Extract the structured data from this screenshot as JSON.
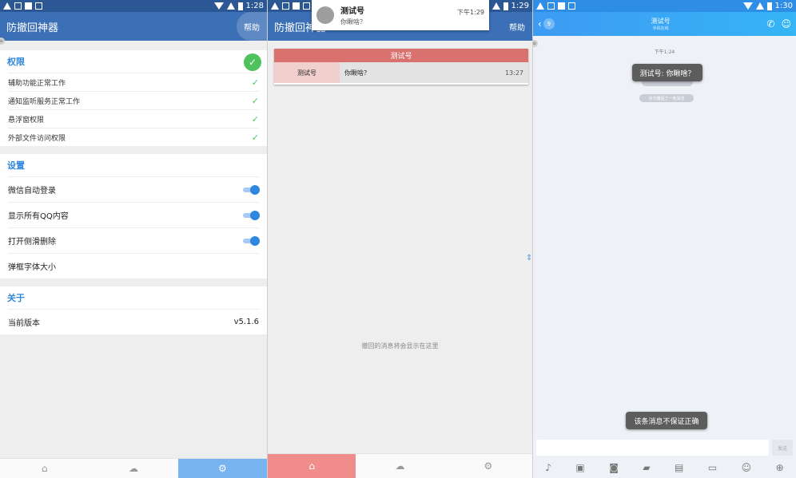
{
  "panel1": {
    "status_time": "1:28",
    "app_title": "防撤回神器",
    "help_label": "帮助",
    "permissions": {
      "title": "权限",
      "items": [
        {
          "label": "辅助功能正常工作"
        },
        {
          "label": "通知监听服务正常工作"
        },
        {
          "label": "悬浮窗权限"
        },
        {
          "label": "外部文件访问权限"
        }
      ]
    },
    "settings": {
      "title": "设置",
      "items": [
        {
          "label": "微信自动登录",
          "toggle": true
        },
        {
          "label": "显示所有QQ内容",
          "toggle": true
        },
        {
          "label": "打开侧滑删除",
          "toggle": true
        },
        {
          "label": "弹框字体大小",
          "toggle": null
        }
      ]
    },
    "about": {
      "title": "关于",
      "version_label": "当前版本",
      "version_value": "v5.1.6"
    }
  },
  "panel2": {
    "status_time": "1:29",
    "app_title": "防撤回神器",
    "help_label": "帮助",
    "notification": {
      "title": "测试号",
      "body": "你瞅啥？",
      "time": "下午1:29"
    },
    "recall_card": {
      "header": "测试号",
      "name": "测试号",
      "message": "你瞅啥？",
      "time": "13:27"
    },
    "empty_text": "撤回的消息将会显示在这里"
  },
  "panel3": {
    "status_time": "1:30",
    "back_badge": "9",
    "contact_name": "测试号",
    "contact_status": "手机在线",
    "chat_time": "下午1:24",
    "toast_message": "测试号: 你瞅啥？",
    "pill_recalled": "对方撤回了一条消息",
    "toast_warning": "该条消息不保证正确",
    "send_label": "发送"
  },
  "colors": {
    "app_blue": "#3b6fb6",
    "accent_blue": "#2f86de",
    "recall_red": "#d9716f",
    "check_green": "#4fc35b",
    "qq_blue": "#3d9bf3"
  }
}
